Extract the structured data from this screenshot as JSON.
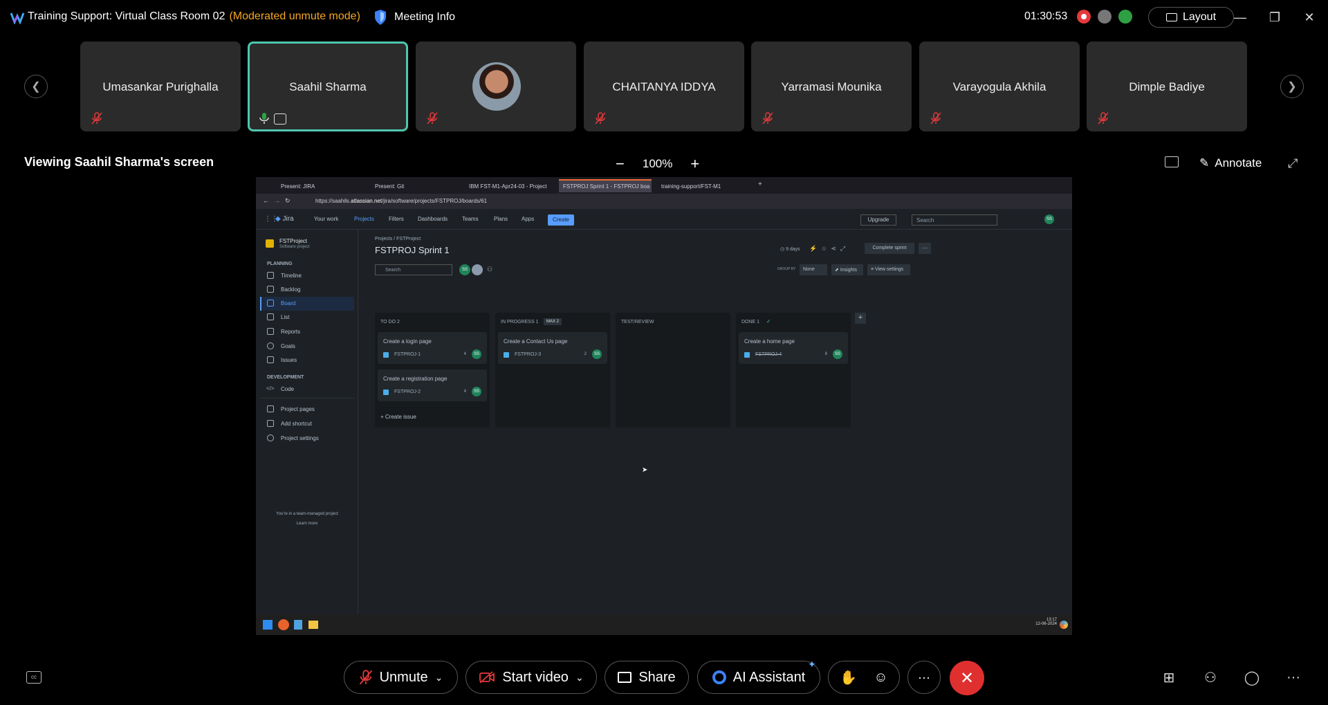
{
  "window": {
    "title": "Training Support: Virtual Class Room 02",
    "mode": "(Moderated unmute mode)",
    "meeting_info": "Meeting Info",
    "timer": "01:30:53",
    "layout_label": "Layout"
  },
  "participants": [
    {
      "name": "Umasankar Purighalla",
      "muted": true
    },
    {
      "name": "Saahil Sharma",
      "active": true,
      "muted": false,
      "sharing": true
    },
    {
      "name": "",
      "photo": true,
      "muted": true
    },
    {
      "name": "CHAITANYA IDDYA",
      "muted": true
    },
    {
      "name": "Yarramasi Mounika",
      "muted": true
    },
    {
      "name": "Varayogula Akhila",
      "muted": true
    },
    {
      "name": "Dimple Badiye",
      "muted": true
    }
  ],
  "share_bar": {
    "viewing_text": "Viewing Saahil Sharma's screen",
    "zoom": "100%",
    "annotate": "Annotate"
  },
  "shared_screen": {
    "tabs": [
      "Present: JIRA",
      "Present: Git",
      "IBM FST-M1-Apr24-03 - Project",
      "FSTPROJ Sprint 1 - FSTPROJ boa",
      "training-support/FST-M1"
    ],
    "url_prefix": "https://saahils.",
    "url_domain": "atlassian.net",
    "url_path": "/jira/software/projects/FSTPROJ/boards/61",
    "nav": {
      "logo": "Jira",
      "items": [
        "Your work",
        "Projects",
        "Filters",
        "Dashboards",
        "Teams",
        "Plans",
        "Apps"
      ],
      "create": "Create",
      "upgrade": "Upgrade",
      "search": "Search",
      "avatar": "SS"
    },
    "sidebar": {
      "project_name": "FSTProject",
      "project_type": "Software project",
      "planning_head": "PLANNING",
      "planning": [
        "Timeline",
        "Backlog",
        "Board",
        "List",
        "Reports",
        "Goals",
        "Issues"
      ],
      "development_head": "DEVELOPMENT",
      "development": [
        "Code"
      ],
      "extra": [
        "Project pages",
        "Add shortcut",
        "Project settings"
      ],
      "footer": "You're in a team-managed project",
      "learn_more": "Learn more"
    },
    "board": {
      "breadcrumb_1": "Projects",
      "breadcrumb_sep": "/",
      "breadcrumb_2": "FSTProject",
      "title": "FSTPROJ Sprint 1",
      "days": "9 days",
      "complete_sprint": "Complete sprint",
      "search": "Search",
      "group_by_label": "GROUP BY",
      "group_by_value": "None",
      "insights": "Insights",
      "view_settings": "View settings",
      "avatar": "SS",
      "create_issue": "+ Create issue",
      "columns": [
        {
          "title": "TO DO 2",
          "badge": "",
          "cards": [
            {
              "title": "Create a login page",
              "key": "FSTPROJ-1",
              "points": "4",
              "avatar": "SS"
            },
            {
              "title": "Create a registration page",
              "key": "FSTPROJ-2",
              "points": "4",
              "avatar": "SS"
            }
          ]
        },
        {
          "title": "IN PROGRESS 1",
          "badge": "MAX 2",
          "cards": [
            {
              "title": "Create a Contact Us page",
              "key": "FSTPROJ-3",
              "points": "2",
              "avatar": "SS"
            }
          ]
        },
        {
          "title": "TEST/REVIEW",
          "badge": "",
          "cards": []
        },
        {
          "title": "DONE 1",
          "badge": "✓",
          "cards": [
            {
              "title": "Create a home page",
              "key": "FSTPROJ-4",
              "points": "8",
              "avatar": "SS"
            }
          ]
        }
      ]
    },
    "taskbar": {
      "time": "13:17",
      "date": "12-06-2024"
    }
  },
  "controls": {
    "unmute": "Unmute",
    "start_video": "Start video",
    "share": "Share",
    "ai_assistant": "AI Assistant"
  }
}
